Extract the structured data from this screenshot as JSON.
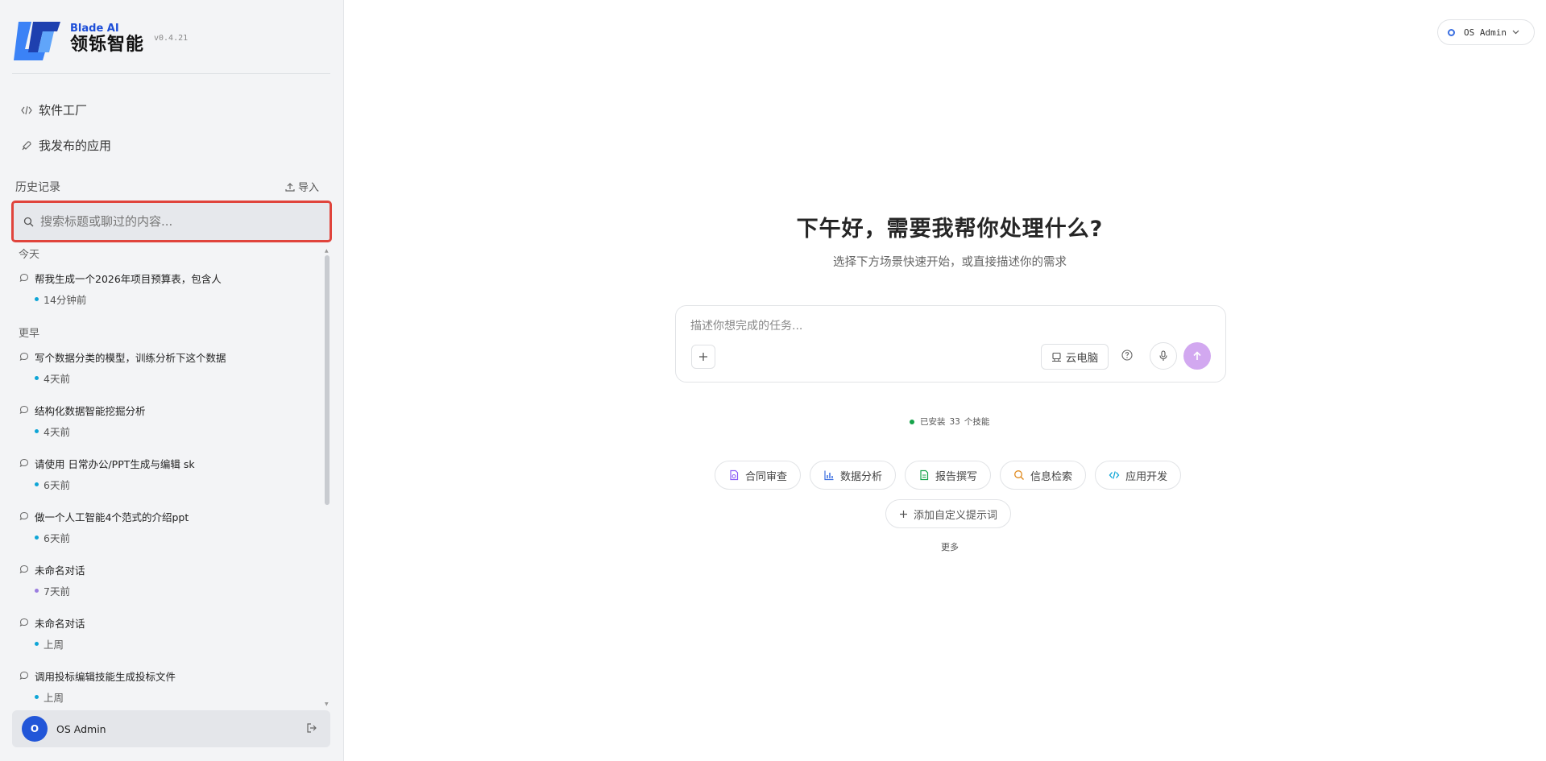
{
  "brand": {
    "name_en": "Blade AI",
    "name_cn": "领铄智能",
    "version": "v0.4.21",
    "logo_icon": "blade-ai-logo",
    "accent_color": "#1d4ed8"
  },
  "nav": {
    "software_factory": "软件工厂",
    "my_apps": "我发布的应用"
  },
  "history": {
    "label": "历史记录",
    "import_label": "导入",
    "search_placeholder": "搜索标题或聊过的内容...",
    "groups": {
      "today": "今天",
      "earlier": "更早"
    },
    "items": [
      {
        "title": "帮我生成一个2026年项目预算表，包含人",
        "time": "14分钟前",
        "dot_color": "#0ea5d6"
      },
      {
        "title": "写个数据分类的模型，训练分析下这个数据",
        "time": "4天前",
        "dot_color": "#0ea5d6"
      },
      {
        "title": "结构化数据智能挖掘分析",
        "time": "4天前",
        "dot_color": "#0ea5d6"
      },
      {
        "title": "请使用 日常办公/PPT生成与编辑 sk",
        "time": "6天前",
        "dot_color": "#0ea5d6"
      },
      {
        "title": "做一个人工智能4个范式的介绍ppt",
        "time": "6天前",
        "dot_color": "#0ea5d6"
      },
      {
        "title": "未命名对话",
        "time": "7天前",
        "dot_color": "#9b7de0"
      },
      {
        "title": "未命名对话",
        "time": "上周",
        "dot_color": "#0ea5d6"
      },
      {
        "title": "调用投标编辑技能生成投标文件",
        "time": "上周",
        "dot_color": "#0ea5d6"
      }
    ]
  },
  "user": {
    "name": "OS Admin",
    "avatar_letter": "O",
    "avatar_color": "#2256d8"
  },
  "main": {
    "greeting": "下午好，需要我帮你处理什么?",
    "subtitle": "选择下方场景快速开始，或直接描述你的需求",
    "input_placeholder": "描述你想完成的任务...",
    "cloud_pc_label": "云电脑",
    "send_color": "#d2a8f0",
    "skills": {
      "prefix": "已安装",
      "count": "33",
      "suffix": "个技能",
      "status_color": "#16a34a"
    },
    "chips": [
      {
        "label": "合同审查",
        "icon": "contract-icon",
        "color": "#8b5cf6"
      },
      {
        "label": "数据分析",
        "icon": "bar-chart-icon",
        "color": "#3b6fe0"
      },
      {
        "label": "报告撰写",
        "icon": "document-icon",
        "color": "#16a34a"
      },
      {
        "label": "信息检索",
        "icon": "search-icon",
        "color": "#e08a1e"
      },
      {
        "label": "应用开发",
        "icon": "code-icon",
        "color": "#0ea5d6"
      }
    ],
    "add_prompt": "添加自定义提示词",
    "more": "更多"
  }
}
